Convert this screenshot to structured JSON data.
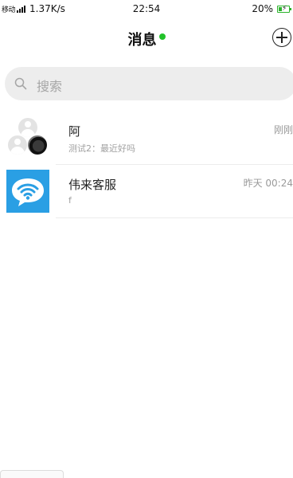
{
  "status_bar": {
    "carrier": "移动",
    "speed": "1.37K/s",
    "time": "22:54",
    "battery": "20%"
  },
  "header": {
    "title": "消息",
    "online_color": "#22c22a"
  },
  "search": {
    "placeholder": "搜索"
  },
  "conversations": [
    {
      "name": "阿",
      "preview": "测试2：最近好吗",
      "time": "刚刚",
      "avatar": "group-avatar"
    },
    {
      "name": "伟来客服",
      "preview": "f",
      "time": "昨天 00:24",
      "avatar": "wifi-service-icon"
    }
  ],
  "colors": {
    "accent_green": "#22c22a",
    "wifi_blue": "#2a9fe4",
    "search_bg": "#ededed"
  }
}
